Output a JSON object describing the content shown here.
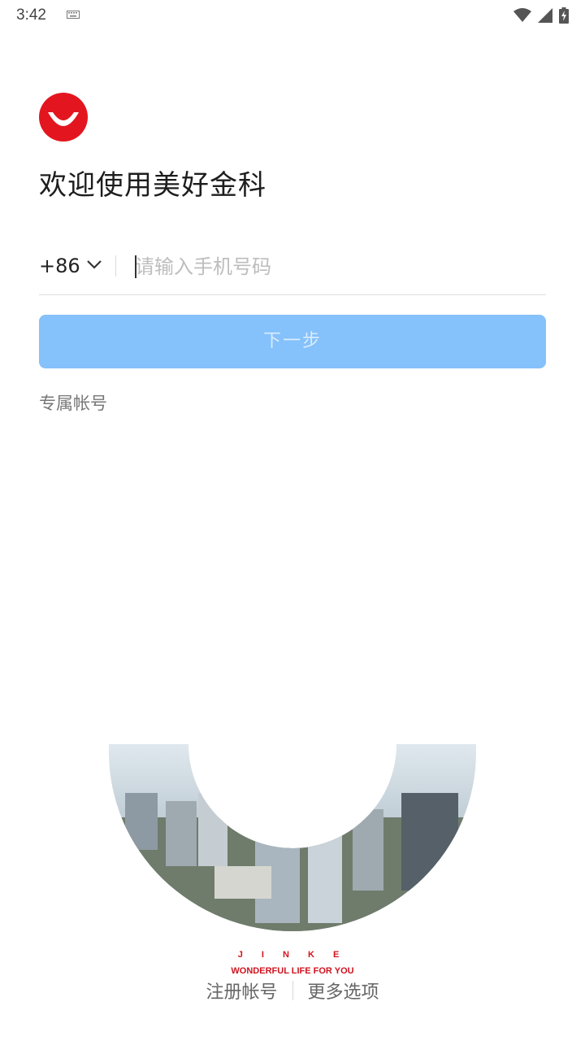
{
  "status_bar": {
    "time": "3:42",
    "icons": [
      "keyboard-icon",
      "wifi-icon",
      "signal-icon",
      "battery-charging-icon"
    ]
  },
  "app": {
    "welcome_title": "欢迎使用美好金科",
    "brand_color": "#e3161f"
  },
  "login_form": {
    "country_code": "+86",
    "phone_placeholder": "请输入手机号码",
    "phone_value": "",
    "next_button_label": "下一步",
    "next_button_color": "#85c1fa",
    "exclusive_account_link": "专属帐号"
  },
  "branding": {
    "jinke": "J I N K E",
    "slogan": "WONDERFUL LIFE FOR YOU"
  },
  "footer": {
    "register_link": "注册帐号",
    "more_options_link": "更多选项"
  }
}
